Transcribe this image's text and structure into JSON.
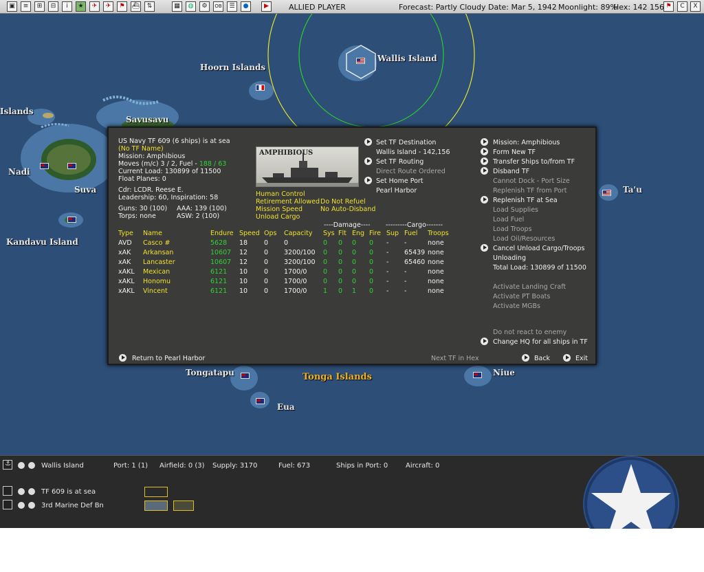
{
  "topbar": {
    "player": "ALLIED PLAYER",
    "forecast": "Forecast: Partly Cloudy",
    "date": "Date: Mar 5, 1942",
    "moonlight": "Moonlight: 89%",
    "hex": "Hex: 142 156",
    "right_btn_c": "C",
    "right_btn_x": "X",
    "btn_ob": "OB"
  },
  "map": {
    "labels": {
      "wallis": "Wallis Island",
      "hoorn": "Hoorn Islands",
      "islands_edge": "Islands",
      "savusavu": "Savusavu",
      "nadi": "Nadi",
      "suva": "Suva",
      "kandavu": "Kandavu Island",
      "tau": "Ta'u",
      "tongatapu": "Tongatapu",
      "tonga": "Tonga Islands",
      "niue": "Niue",
      "eua": "Eua"
    }
  },
  "dialog": {
    "header": "US Navy TF 609 (6 ships) is at sea",
    "tf_name": "(No TF Name)",
    "mission": "Mission: Amphibious",
    "moves_label": "Moves (m/c) 3 / 2, Fuel - ",
    "fuel_value": "188 / 63",
    "current_load": "Current Load: 130899 of 11500",
    "float_planes": "Float Planes: 0",
    "cdr": "Cdr: LCDR. Reese E.",
    "leadership": "Leadership: 60, Inspiration: 58",
    "guns": "Guns: 30 (100)",
    "aaa": "AAA: 139 (100)",
    "torps": "Torps: none",
    "asw": "ASW: 2 (100)",
    "image_caption": "AMPHIBIOUS",
    "human_control": "Human Control",
    "retirement": "Retirement Allowed",
    "do_not_refuel": "Do Not Refuel",
    "mission_speed": "Mission Speed",
    "no_auto_disband": "No Auto-Disband",
    "unload_cargo": "Unload Cargo",
    "actions_mid": {
      "set_destination": "Set TF Destination",
      "destination_value": "Wallis Island - 142,156",
      "set_routing": "Set TF Routing",
      "route_value": "Direct Route Ordered",
      "set_home_port": "Set Home Port",
      "home_port_value": "Pearl Harbor"
    },
    "actions_right": {
      "mission": "Mission: Amphibious",
      "form_new": "Form New TF",
      "transfer": "Transfer Ships to/from TF",
      "disband": "Disband TF",
      "cannot_dock": "Cannot Dock - Port Size",
      "replenish_port": "Replenish TF from Port",
      "replenish_sea": "Replenish TF at Sea",
      "load_supplies": "Load Supplies",
      "load_fuel": "Load Fuel",
      "load_troops": "Load Troops",
      "load_oil": "Load Oil/Resources",
      "cancel_unload": "Cancel Unload Cargo/Troops",
      "unloading": "Unloading",
      "total_load": "Total Load: 130899 of 11500",
      "landing_craft": "Activate Landing Craft",
      "pt_boats": "Activate PT Boats",
      "mgbs": "Activate MGBs",
      "no_react": "Do not react to enemy",
      "change_hq": "Change HQ for all ships in TF"
    },
    "damage_group": "----Damage----",
    "cargo_group": "---------Cargo-------",
    "columns": [
      "Type",
      "Name",
      "Endure",
      "Speed",
      "Ops",
      "Capacity",
      "Sys",
      "Flt",
      "Eng",
      "Fire",
      "Sup",
      "Fuel",
      "Troops"
    ],
    "ships": [
      [
        "AVD",
        "Casco #",
        "5628",
        "18",
        "0",
        "0",
        "0",
        "0",
        "0",
        "0",
        "-",
        "-",
        "none"
      ],
      [
        "xAK",
        "Arkansan",
        "10607",
        "12",
        "0",
        "3200/100",
        "0",
        "0",
        "0",
        "0",
        "-",
        "65439",
        "none"
      ],
      [
        "xAK",
        "Lancaster",
        "10607",
        "12",
        "0",
        "3200/100",
        "0",
        "0",
        "0",
        "0",
        "-",
        "65460",
        "none"
      ],
      [
        "xAKL",
        "Mexican",
        "6121",
        "10",
        "0",
        "1700/0",
        "0",
        "0",
        "0",
        "0",
        "-",
        "-",
        "none"
      ],
      [
        "xAKL",
        "Honomu",
        "6121",
        "10",
        "0",
        "1700/0",
        "0",
        "0",
        "0",
        "0",
        "-",
        "-",
        "none"
      ],
      [
        "xAKL",
        "Vincent",
        "6121",
        "10",
        "0",
        "1700/0",
        "1",
        "0",
        "1",
        "0",
        "-",
        "-",
        "none"
      ]
    ],
    "return": "Return to Pearl Harbor",
    "next_tf": "Next TF in Hex",
    "back": "Back",
    "exit": "Exit"
  },
  "bottom": {
    "location": "Wallis Island",
    "port": "Port: 1 (1)",
    "airfield": "Airfield: 0 (3)",
    "supply": "Supply: 3170",
    "fuel": "Fuel: 673",
    "ships_in_port": "Ships in Port: 0",
    "aircraft": "Aircraft: 0",
    "tf_status": "TF 609 is at sea",
    "unit": "3rd Marine Def Bn"
  },
  "colors": {
    "accent_yellow": "#f0e030",
    "endure_green": "#32d232",
    "sea": "#2d4e76",
    "panel": "#3b3c3a"
  }
}
